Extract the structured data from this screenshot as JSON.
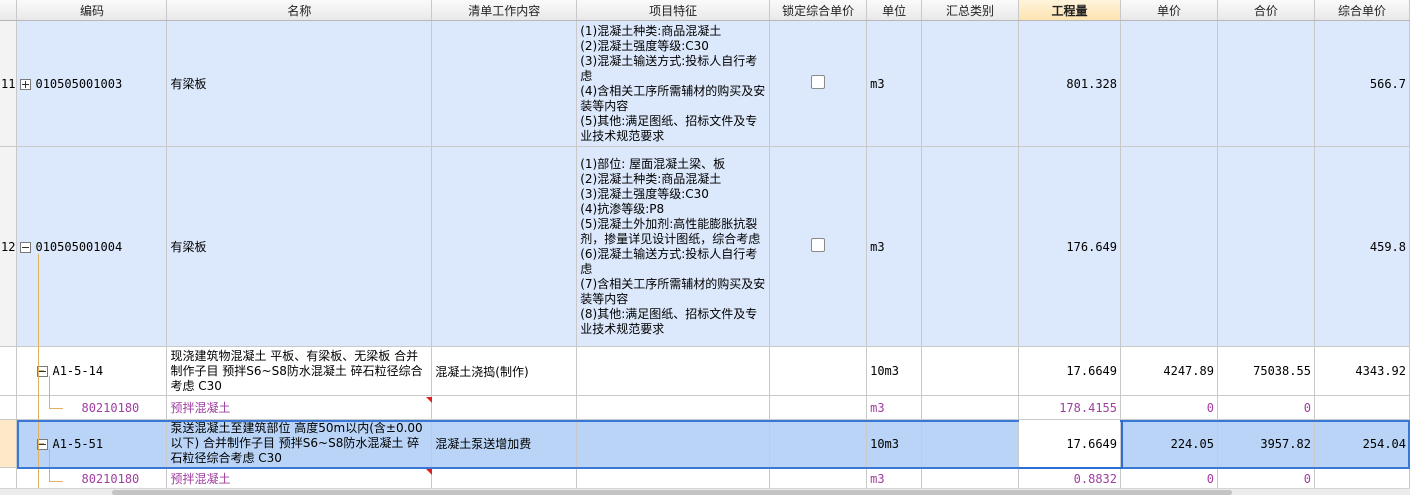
{
  "columns": {
    "code": "编码",
    "name": "名称",
    "work": "清单工作内容",
    "feature": "项目特征",
    "lock": "锁定综合单价",
    "unit": "单位",
    "category": "汇总类别",
    "qty": "工程量",
    "price": "单价",
    "total": "合价",
    "composite": "综合单价"
  },
  "rows": {
    "r11": {
      "no": "11",
      "code": "010505001003",
      "name": "有梁板",
      "feature": "(1)混凝土种类:商品混凝土\n(2)混凝土强度等级:C30\n(3)混凝土输送方式:投标人自行考虑\n(4)含相关工序所需辅材的购买及安装等内容\n(5)其他:满足图纸、招标文件及专业技术规范要求",
      "unit": "m3",
      "qty": "801.328",
      "composite": "566.7"
    },
    "r12": {
      "no": "12",
      "code": "010505001004",
      "name": "有梁板",
      "feature": "(1)部位: 屋面混凝土梁、板\n(2)混凝土种类:商品混凝土\n(3)混凝土强度等级:C30\n(4)抗渗等级:P8\n(5)混凝土外加剂:高性能膨胀抗裂剂，掺量详见设计图纸，综合考虑\n(6)混凝土输送方式:投标人自行考虑\n(7)含相关工序所需辅材的购买及安装等内容\n(8)其他:满足图纸、招标文件及专业技术规范要求",
      "unit": "m3",
      "qty": "176.649",
      "composite": "459.8"
    },
    "a1514": {
      "code": "A1-5-14",
      "name": "现浇建筑物混凝土  平板、有梁板、无梁板  合并制作子目  预拌S6~S8防水混凝土  碎石粒径综合考虑  C30",
      "work": "混凝土浇捣(制作)",
      "unit": "10m3",
      "qty": "17.6649",
      "price": "4247.89",
      "total": "75038.55",
      "composite": "4343.92"
    },
    "m1": {
      "code": "80210180",
      "name": "预拌混凝土",
      "unit": "m3",
      "qty": "178.4155",
      "price": "0",
      "total": "0"
    },
    "a1551": {
      "code": "A1-5-51",
      "name": "泵送混凝土至建筑部位  高度50m以内(含±0.00以下)   合并制作子目  预拌S6~S8防水混凝土  碎石粒径综合考虑  C30",
      "work": "混凝土泵送增加费",
      "unit": "10m3",
      "qty": "17.6649",
      "price": "224.05",
      "total": "3957.82",
      "composite": "254.04"
    },
    "m2": {
      "code": "80210180",
      "name": "预拌混凝土",
      "unit": "m3",
      "qty": "0.8832",
      "price": "0",
      "total": "0"
    }
  },
  "colors": {
    "header_highlight": "#fde3b0",
    "row_blue": "#dce8fb",
    "row_selected": "#b9d4f6",
    "material_text": "#a03ea0"
  }
}
